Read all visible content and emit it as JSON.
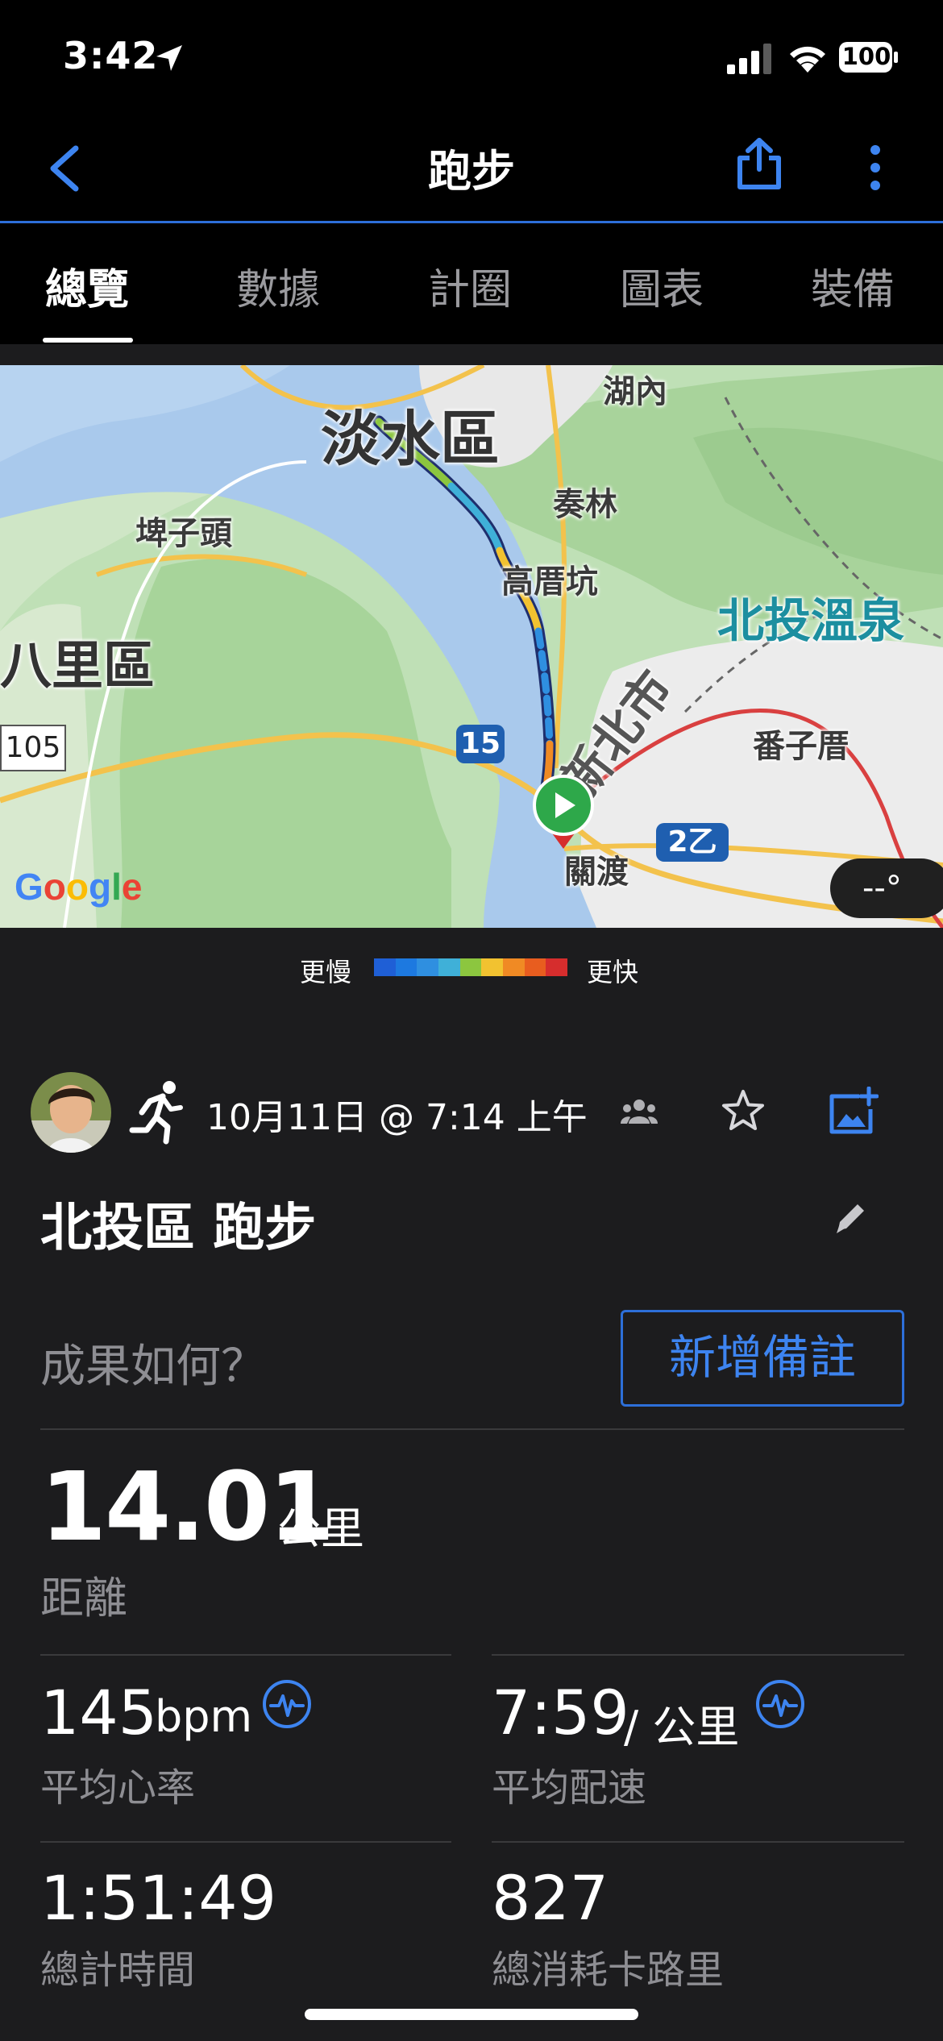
{
  "status_bar": {
    "time": "3:42",
    "battery": "100"
  },
  "nav": {
    "title": "跑步"
  },
  "tabs": [
    {
      "label": "總覽"
    },
    {
      "label": "數據"
    },
    {
      "label": "計圈"
    },
    {
      "label": "圖表"
    },
    {
      "label": "裝備"
    }
  ],
  "map": {
    "labels": {
      "tamsui": "淡水區",
      "hunei": "湖內",
      "zoulin": "奏林",
      "pizitou": "埤子頭",
      "gaoshankeng": "高厝坑",
      "beitou_hotspring": "北投溫泉",
      "bali": "八里區",
      "new_taipei": "新北市",
      "fanzicuo": "番子厝",
      "guandu": "關渡"
    },
    "roads": {
      "r105": "105",
      "r15": "15",
      "r2b": "2乙"
    },
    "attribution": "Google",
    "weather": "--°",
    "route_colors": [
      "#1f5fd6",
      "#2f8fe0",
      "#3fb0d8",
      "#8cc63f",
      "#f2c230",
      "#f08a24",
      "#d62d2d"
    ]
  },
  "legend": {
    "slower": "更慢",
    "faster": "更快",
    "colors": [
      "#1f5fd6",
      "#1d79e0",
      "#2f8fe0",
      "#3fb0d8",
      "#8cc63f",
      "#f2c230",
      "#f08a24",
      "#e85d1f",
      "#d62d2d"
    ]
  },
  "activity": {
    "date": "10月11日 @ 7:14 上午",
    "title": "北投區 跑步",
    "prompt": "成果如何？",
    "add_note": "新增備註"
  },
  "metrics": {
    "distance": {
      "value": "14.01",
      "unit": "公里",
      "label": "距離"
    },
    "heart_rate": {
      "value": "145",
      "unit": "bpm",
      "label": "平均心率"
    },
    "pace": {
      "value": "7:59",
      "unit": "/ 公里",
      "label": "平均配速"
    },
    "time": {
      "value": "1:51:49",
      "label": "總計時間"
    },
    "calories": {
      "value": "827",
      "label": "總消耗卡路里"
    }
  }
}
